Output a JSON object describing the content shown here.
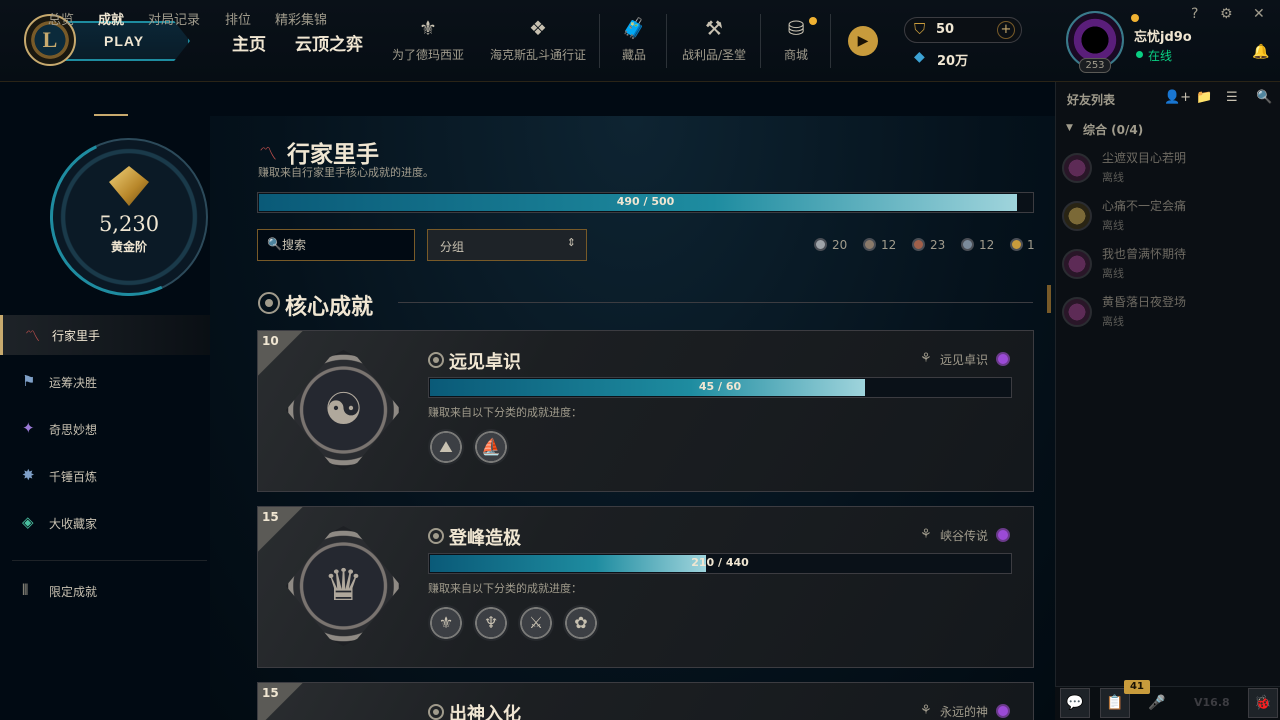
{
  "topbar": {
    "play_label": "PLAY",
    "nav": [
      "主页",
      "云顶之弈"
    ],
    "icons": [
      {
        "name": "demacia-icon",
        "glyph": "⚜",
        "label": "为了德玛西亚"
      },
      {
        "name": "hextech-pass-icon",
        "glyph": "❖",
        "label": "海克斯乱斗通行证"
      },
      {
        "name": "collection-icon",
        "glyph": "🧳",
        "label": "藏品"
      },
      {
        "name": "loot-icon",
        "glyph": "⚒",
        "label": "战利品/圣堂"
      },
      {
        "name": "store-icon",
        "glyph": "⛁",
        "label": "商城"
      }
    ],
    "chest_glyph": "▶",
    "rp": "50",
    "be": "20万",
    "add_glyph": "+",
    "level": "253",
    "username": "忘忧jd9o",
    "status": "在线",
    "window_buttons": [
      "?",
      "⚙",
      "✕"
    ],
    "bell_glyph": "🔔"
  },
  "subnav": {
    "tabs": [
      "总览",
      "成就",
      "对局记录",
      "排位",
      "精彩集锦"
    ],
    "active_index": 1
  },
  "rank": {
    "points": "5,230",
    "tier": "黄金阶"
  },
  "sidebar": {
    "items": [
      {
        "label": "行家里手",
        "glyph": "〽",
        "active": true
      },
      {
        "label": "运筹决胜",
        "glyph": "⚑",
        "active": false
      },
      {
        "label": "奇思妙想",
        "glyph": "✦",
        "active": false
      },
      {
        "label": "千锤百炼",
        "glyph": "✸",
        "active": false
      },
      {
        "label": "大收藏家",
        "glyph": "◈",
        "active": false
      }
    ],
    "limited": {
      "label": "限定成就",
      "glyph": "⫴"
    }
  },
  "main": {
    "title": "行家里手",
    "title_glyph": "〽",
    "description": "赚取来自行家里手核心成就的进度。",
    "progress": {
      "text": "490 / 500",
      "current": 490,
      "max": 500
    },
    "search_placeholder": "搜索",
    "search_glyph": "🔍",
    "group_label": "分组",
    "group_arrow": "⌃⌄",
    "tier_counts": [
      {
        "count": "20",
        "color": "#9ea3a8"
      },
      {
        "count": "12",
        "color": "#8a7a6a"
      },
      {
        "count": "23",
        "color": "#a0604a"
      },
      {
        "count": "12",
        "color": "#7a8a9a"
      },
      {
        "count": "1",
        "color": "#c89b3c"
      }
    ],
    "section_title": "核心成就"
  },
  "cards": [
    {
      "level": "10",
      "title": "远见卓识",
      "tag": "远见卓识",
      "progress": {
        "text": "45 / 60",
        "current": 45,
        "max": 60
      },
      "desc": "赚取来自以下分类的成就进度：",
      "symbol": "☯",
      "sub_icons": [
        "⛰",
        "⛵"
      ]
    },
    {
      "level": "15",
      "title": "登峰造极",
      "tag": "峡谷传说",
      "progress": {
        "text": "210 / 440",
        "current": 210,
        "max": 440
      },
      "desc": "赚取来自以下分类的成就进度：",
      "symbol": "♛",
      "sub_icons": [
        "⚜",
        "♆",
        "⚔",
        "✿"
      ]
    },
    {
      "level": "15",
      "title": "出神入化",
      "tag": "永远的神",
      "symbol": "♔"
    }
  ],
  "friends": {
    "title": "好友列表",
    "tools": [
      "👤+",
      "📁",
      "☰",
      "🔍"
    ],
    "group_label": "综合 (0/4)",
    "list": [
      {
        "name": "尘遮双目心若明",
        "status": "离线"
      },
      {
        "name": "心痛不一定会痛",
        "status": "离线"
      },
      {
        "name": "我也曾满怀期待",
        "status": "离线"
      },
      {
        "name": "黄昏落日夜登场",
        "status": "离线"
      }
    ]
  },
  "bottom": {
    "chat_glyph": "💬",
    "missions_glyph": "📋",
    "mic_glyph": "🎤",
    "bug_glyph": "🐞",
    "badge": "41",
    "version": "V16.8"
  }
}
